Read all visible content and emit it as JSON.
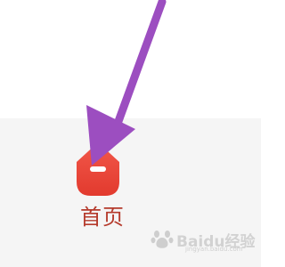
{
  "tab_bar": {
    "home": {
      "label": "首页",
      "icon": "home-icon",
      "color": "#e8443a"
    }
  },
  "annotation": {
    "arrow_color": "#9c4ec0"
  },
  "watermark": {
    "text": "Baidu经验",
    "url": "jingyan.baidu.com"
  }
}
